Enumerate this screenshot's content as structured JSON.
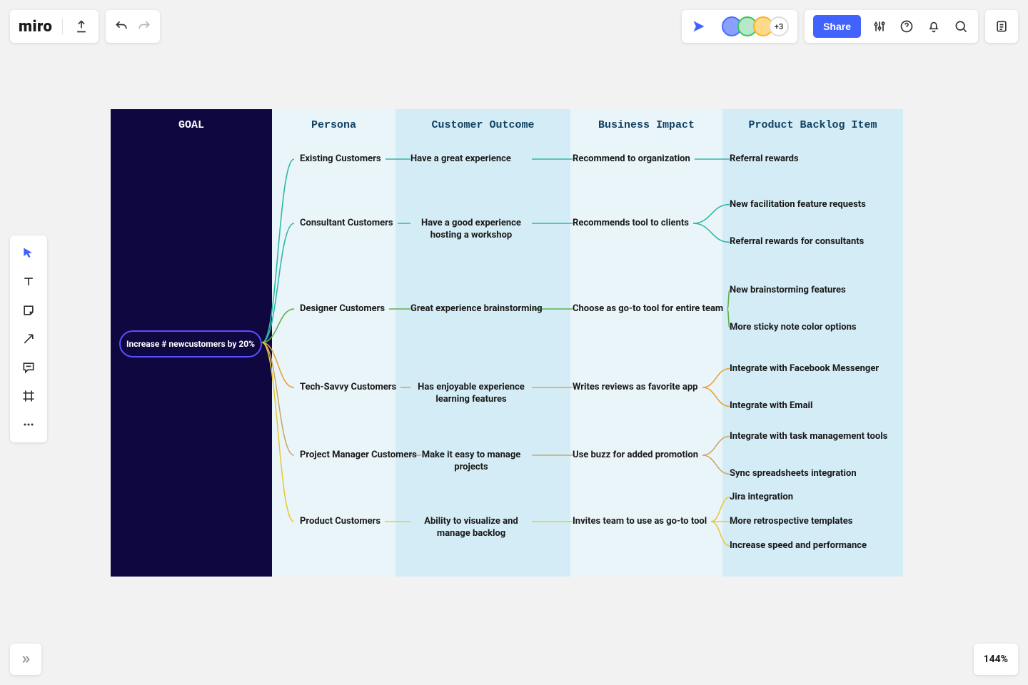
{
  "brand": "miro",
  "toolbar": {
    "share_label": "Share",
    "avatar_extra": "+3"
  },
  "zoom": "144%",
  "headers": {
    "goal": "GOAL",
    "persona": "Persona",
    "outcome": "Customer Outcome",
    "impact": "Business Impact",
    "backlog": "Product Backlog Item"
  },
  "goal_text": "Increase # newcustomers by 20%",
  "colors": {
    "teal": "#2fb8a6",
    "green": "#5fb04a",
    "orange": "#e8a23a",
    "yellow": "#e8c83a",
    "tan": "#c9a86a"
  },
  "rows": [
    {
      "color": "teal",
      "persona": "Existing Customers",
      "outcome": "Have a great experience",
      "impact": "Recommend to organization",
      "backlog": [
        "Referral rewards"
      ]
    },
    {
      "color": "teal",
      "persona": "Consultant Customers",
      "outcome": "Have a good experience hosting a workshop",
      "impact": "Recommends tool to clients",
      "backlog": [
        "New facilitation feature requests",
        "Referral rewards for consultants"
      ]
    },
    {
      "color": "green",
      "persona": "Designer Customers",
      "outcome": "Great experience brainstorming",
      "impact": "Choose as go-to tool for entire team",
      "backlog": [
        "New brainstorming features",
        "More sticky note color options"
      ]
    },
    {
      "color": "orange",
      "persona": "Tech-Savvy Customers",
      "outcome": "Has enjoyable experience learning features",
      "impact": "Writes reviews as favorite app",
      "backlog": [
        "Integrate with Facebook Messenger",
        "Integrate with Email"
      ]
    },
    {
      "color": "tan",
      "persona": "Project Manager Customers",
      "outcome": "Make it easy to manage projects",
      "impact": "Use buzz for added promotion",
      "backlog": [
        "Integrate with task management tools",
        "Sync spreadsheets integration"
      ]
    },
    {
      "color": "yellow",
      "persona": "Product Customers",
      "outcome": "Ability to visualize and manage backlog",
      "impact": "Invites team to use as go-to tool",
      "backlog": [
        "Jira integration",
        "More retrospective templates",
        "Increase speed and performance"
      ]
    }
  ]
}
